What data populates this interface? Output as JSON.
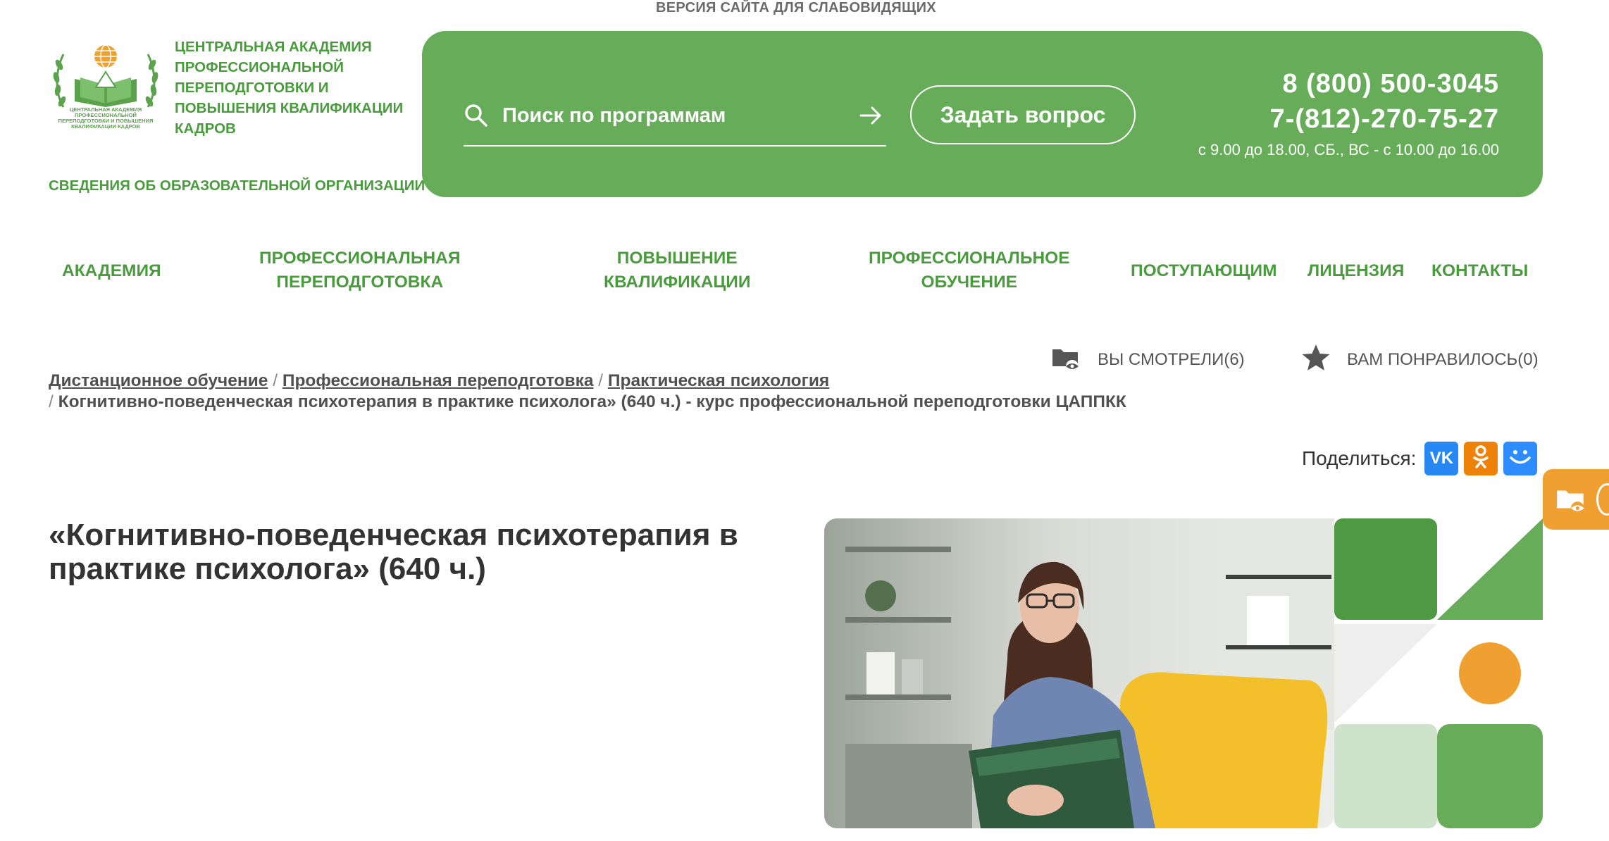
{
  "top_link": "ВЕРСИЯ САЙТА ДЛЯ СЛАБОВИДЯЩИХ",
  "logo": {
    "caption": [
      "ЦЕНТРАЛЬНАЯ АКАДЕМИЯ",
      "ПРОФЕССИОНАЛЬНОЙ",
      "ПЕРЕПОДГОТОВКИ И ПОВЫШЕНИЯ",
      "КВАЛИФИКАЦИИ КАДРОВ"
    ]
  },
  "header": {
    "org_name": "ЦЕНТРАЛЬНАЯ АКАДЕМИЯ ПРОФЕССИОНАЛЬНОЙ ПЕРЕПОДГОТОВКИ И ПОВЫШЕНИЯ КВАЛИФИКАЦИИ КАДРОВ",
    "org_info_link": "СВЕДЕНИЯ ОБ ОБРАЗОВАТЕЛЬНОЙ ОРГАНИЗАЦИИ",
    "search_placeholder": "Поиск по программам",
    "ask_button": "Задать вопрос",
    "phone1": "8 (800) 500-3045",
    "phone2": "7-(812)-270-75-27",
    "hours": "с 9.00 до 18.00, СБ., ВС - с 10.00 до 16.00"
  },
  "nav": [
    {
      "line1": "АКАДЕМИЯ",
      "line2": ""
    },
    {
      "line1": "ПРОФЕССИОНАЛЬНАЯ",
      "line2": "ПЕРЕПОДГОТОВКА"
    },
    {
      "line1": "ПОВЫШЕНИЕ",
      "line2": "КВАЛИФИКАЦИИ"
    },
    {
      "line1": "ПРОФЕССИОНАЛЬНОЕ",
      "line2": "ОБУЧЕНИЕ"
    },
    {
      "line1": "ПОСТУПАЮЩИМ",
      "line2": ""
    },
    {
      "line1": "ЛИЦЕНЗИЯ",
      "line2": ""
    },
    {
      "line1": "КОНТАКТЫ",
      "line2": ""
    }
  ],
  "utility": {
    "viewed": "ВЫ СМОТРЕЛИ(6)",
    "liked": "ВАМ ПОНРАВИЛОСЬ(0)"
  },
  "breadcrumb": {
    "items": [
      "Дистанционное обучение",
      "Профессиональная переподготовка",
      "Практическая психология"
    ],
    "current": "Когнитивно-поведенческая психотерапия в практике психолога» (640 ч.) - курс профессиональной переподготовки ЦАППКК",
    "separator": "/"
  },
  "share": {
    "label": "Поделиться:",
    "vk": "VK",
    "ok": "ОК"
  },
  "course": {
    "title": "«Когнитивно-поведенческая психотерапия в практике психолога» (640 ч.)"
  },
  "colors": {
    "brand_green": "#66ac59",
    "text_green": "#4a9a3e",
    "orange": "#f0a030"
  }
}
